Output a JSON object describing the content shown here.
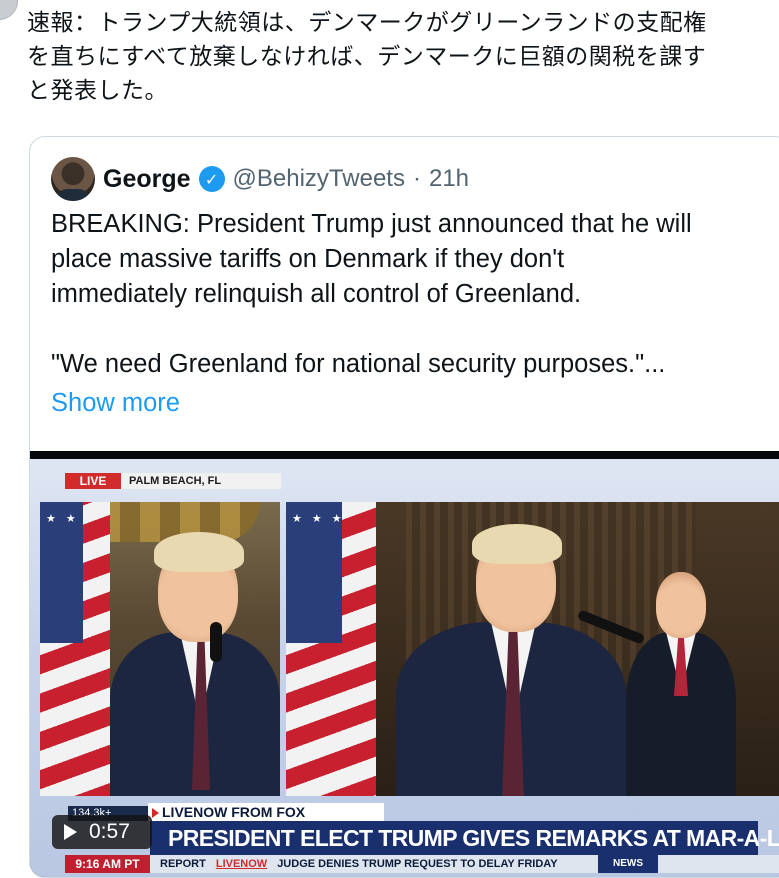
{
  "post": {
    "text": "速報：トランプ大統領は、デンマークがグリーンランドの支配権\nを直ちにすべて放棄しなければ、デンマークに巨額の関税を課す\nと発表した。"
  },
  "quote": {
    "name": "George",
    "handle": "@BehizyTweets",
    "dot": "·",
    "time": "21h",
    "body": "BREAKING: President Trump just announced that he will\nplace massive tariffs on Denmark if they don't\nimmediately relinquish all control of Greenland.\n\n\"We need Greenland for national security purposes.\"...",
    "show_more": "Show more",
    "verified_color": "#1d9bf0"
  },
  "video": {
    "live": "LIVE",
    "location": "PALM BEACH, FL",
    "views": "134.3k+",
    "source": "LIVENOW FROM FOX",
    "headline": "PRESIDENT ELECT TRUMP GIVES REMARKS AT MAR-A-LAGO",
    "time_of_day": "9:16 AM PT",
    "ticker_a": "REPORT",
    "ticker_brand": "LIVENOW",
    "ticker_b": "JUDGE DENIES TRUMP REQUEST TO DELAY FRIDAY",
    "ticker_c": "NEWS",
    "duration": "0:57",
    "flag_stars": "★★★★★★★★★★★★★★★★★★★★★★★★★"
  }
}
